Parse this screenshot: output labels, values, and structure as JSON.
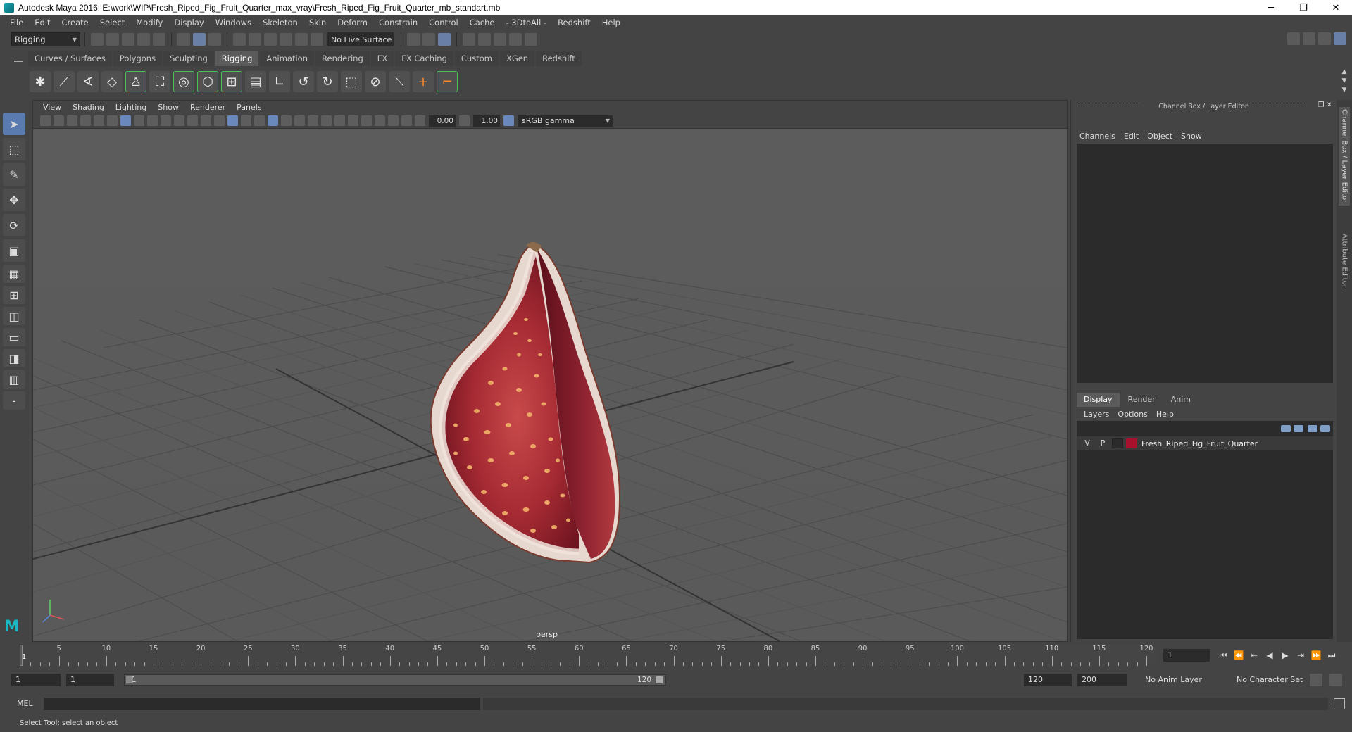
{
  "window": {
    "title": "Autodesk Maya 2016: E:\\work\\WIP\\Fresh_Riped_Fig_Fruit_Quarter_max_vray\\Fresh_Riped_Fig_Fruit_Quarter_mb_standart.mb",
    "minimize": "─",
    "restore": "❐",
    "close": "✕"
  },
  "menus": [
    "File",
    "Edit",
    "Create",
    "Select",
    "Modify",
    "Display",
    "Windows",
    "Skeleton",
    "Skin",
    "Deform",
    "Constrain",
    "Control",
    "Cache",
    "- 3DtoAll -",
    "Redshift",
    "Help"
  ],
  "statusline": {
    "mode": "Rigging",
    "live_surface": "No Live Surface"
  },
  "shelf": {
    "tabs": [
      "Curves / Surfaces",
      "Polygons",
      "Sculpting",
      "Rigging",
      "Animation",
      "Rendering",
      "FX",
      "FX Caching",
      "Custom",
      "XGen",
      "Redshift"
    ],
    "active_tab": "Rigging"
  },
  "viewport": {
    "menus": [
      "View",
      "Shading",
      "Lighting",
      "Show",
      "Renderer",
      "Panels"
    ],
    "exposure": "0.00",
    "gamma_value": "1.00",
    "color_space": "sRGB gamma",
    "camera": "persp"
  },
  "channel_box": {
    "title": "Channel Box / Layer Editor",
    "menus": [
      "Channels",
      "Edit",
      "Object",
      "Show"
    ],
    "layer_tabs": [
      "Display",
      "Render",
      "Anim"
    ],
    "active_layer_tab": "Display",
    "layer_menus": [
      "Layers",
      "Options",
      "Help"
    ],
    "layers": [
      {
        "visible": "V",
        "playback": "P",
        "name": "Fresh_Riped_Fig_Fruit_Quarter",
        "color": "#a8112e"
      }
    ]
  },
  "side_tabs": {
    "channel_box": "Channel Box / Layer Editor",
    "attribute_editor": "Attribute Editor"
  },
  "timeline": {
    "ticks": [
      1,
      5,
      10,
      15,
      20,
      25,
      30,
      35,
      40,
      45,
      50,
      55,
      60,
      65,
      70,
      75,
      80,
      85,
      90,
      95,
      100,
      105,
      110,
      115,
      120
    ],
    "current_frame": "1"
  },
  "range": {
    "start": "1",
    "playback_start": "1",
    "slider_start": "1",
    "slider_end": "120",
    "playback_end": "120",
    "end": "200",
    "anim_layer": "No Anim Layer",
    "character_set": "No Character Set"
  },
  "command_line": {
    "label": "MEL"
  },
  "help_line": {
    "text": "Select Tool: select an object"
  }
}
